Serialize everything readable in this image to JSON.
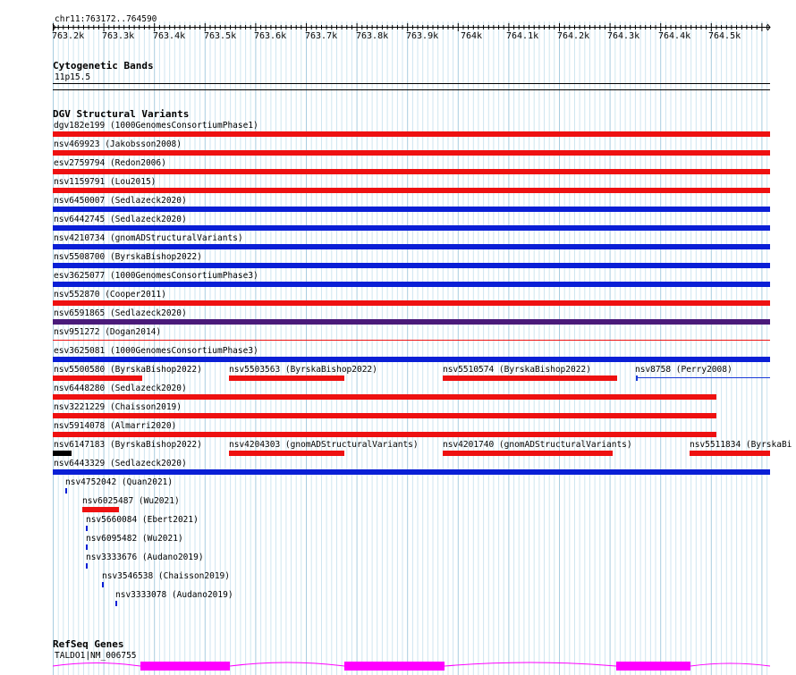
{
  "ruler": {
    "region": "chr11:763172..764590",
    "ticks": [
      "763.2k",
      "763.3k",
      "763.4k",
      "763.5k",
      "763.6k",
      "763.7k",
      "763.8k",
      "763.9k",
      "764k",
      "764.1k",
      "764.2k",
      "764.3k",
      "764.4k",
      "764.5k"
    ]
  },
  "cytobands": {
    "title": "Cytogenetic Bands",
    "band": "11p15.5"
  },
  "dgv": {
    "title": "DGV Structural Variants",
    "colors": {
      "red": "#ee1111",
      "blue": "#0a1fd6",
      "purple": "#4a1a7a",
      "black": "#000000",
      "line_blue": "#1a3ad8"
    },
    "labels": [
      "dgv182e199 (1000GenomesConsortiumPhase1)",
      "nsv469923 (Jakobsson2008)",
      "esv2759794 (Redon2006)",
      "nsv1159791 (Lou2015)",
      "nsv6450007 (Sedlazeck2020)",
      "nsv6442745 (Sedlazeck2020)",
      "nsv4210734 (gnomADStructuralVariants)",
      "nsv5508700 (ByrskaBishop2022)",
      "esv3625077 (1000GenomesConsortiumPhase3)",
      "nsv552870 (Cooper2011)",
      "nsv6591865 (Sedlazeck2020)",
      "nsv951272 (Dogan2014)",
      "esv3625081 (1000GenomesConsortiumPhase3)",
      "nsv5500580 (ByrskaBishop2022)",
      "nsv5503563 (ByrskaBishop2022)",
      "nsv5510574 (ByrskaBishop2022)",
      "nsv8758 (Perry2008)",
      "nsv6448280 (Sedlazeck2020)",
      "nsv3221229 (Chaisson2019)",
      "nsv5914078 (Almarri2020)",
      "nsv6147183 (ByrskaBishop2022)",
      "nsv4204303 (gnomADStructuralVariants)",
      "nsv4201740 (gnomADStructuralVariants)",
      "nsv5511834 (ByrskaBi",
      "nsv6443329 (Sedlazeck2020)",
      "nsv4752042 (Quan2021)",
      "nsv6025487 (Wu2021)",
      "nsv5660084 (Ebert2021)",
      "nsv6095482 (Wu2021)",
      "nsv3333676 (Audano2019)",
      "nsv3546538 (Chaisson2019)",
      "nsv3333078 (Audano2019)"
    ]
  },
  "refseq": {
    "title": "RefSeq Genes",
    "gene": "TALDO1|NM_006755",
    "exon_color": "#ff00ff"
  }
}
